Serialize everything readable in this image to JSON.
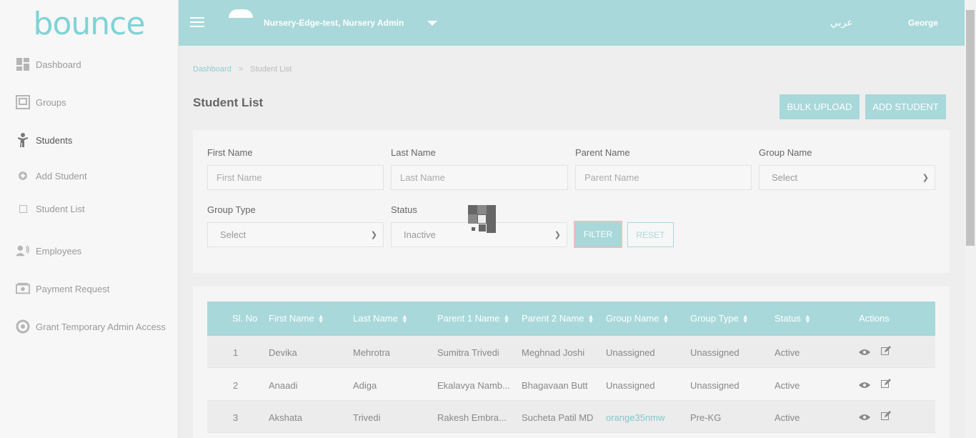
{
  "logo": {
    "text": "bounce"
  },
  "sidebar": {
    "items": [
      {
        "label": "Dashboard",
        "icon": "dashboard-icon"
      },
      {
        "label": "Groups",
        "icon": "groups-icon"
      },
      {
        "label": "Students",
        "icon": "student-icon"
      },
      {
        "label": "Employees",
        "icon": "employees-icon"
      },
      {
        "label": "Payment Request",
        "icon": "payment-icon"
      },
      {
        "label": "Grant Temporary Admin Access",
        "icon": "admin-access-icon"
      }
    ],
    "sub_items": [
      {
        "label": "Add Student",
        "icon": "plus-circle-icon"
      },
      {
        "label": "Student List",
        "icon": "square-icon"
      }
    ]
  },
  "header": {
    "org": "Nursery-Edge-test, Nursery Admin",
    "lang": "عربي",
    "user": "George"
  },
  "breadcrumb": {
    "home": "Dashboard",
    "separator": ">",
    "current": "Student List"
  },
  "page": {
    "title": "Student List",
    "bulk_upload": "BULK UPLOAD",
    "add_student": "ADD STUDENT"
  },
  "filters": {
    "first_name": {
      "label": "First Name",
      "placeholder": "First Name"
    },
    "last_name": {
      "label": "Last Name",
      "placeholder": "Last Name"
    },
    "parent_name": {
      "label": "Parent Name",
      "placeholder": "Parent Name"
    },
    "group_name": {
      "label": "Group Name",
      "value": "Select"
    },
    "group_type": {
      "label": "Group Type",
      "value": "Select"
    },
    "status": {
      "label": "Status",
      "value": "Inactive"
    },
    "filter_btn": "FILTER",
    "reset_btn": "RESET"
  },
  "table": {
    "headers": [
      "Sl. No",
      "First Name",
      "Last Name",
      "Parent 1 Name",
      "Parent 2 Name",
      "Group Name",
      "Group Type",
      "Status",
      "Actions"
    ],
    "rows": [
      [
        "1",
        "Devika",
        "Mehrotra",
        "Sumitra Trivedi",
        "Meghnad Joshi",
        "Unassigned",
        "Unassigned",
        "Active"
      ],
      [
        "2",
        "Anaadi",
        "Adiga",
        "Ekalavya Namb...",
        "Bhagavaan Butt",
        "Unassigned",
        "Unassigned",
        "Active"
      ],
      [
        "3",
        "Akshata",
        "Trivedi",
        "Rakesh Embra...",
        "Sucheta Patil MD",
        "orange35nmw",
        "Pre-KG",
        "Active"
      ]
    ]
  },
  "colors": {
    "accent": "#a8d8da",
    "link": "#7fcacd"
  }
}
